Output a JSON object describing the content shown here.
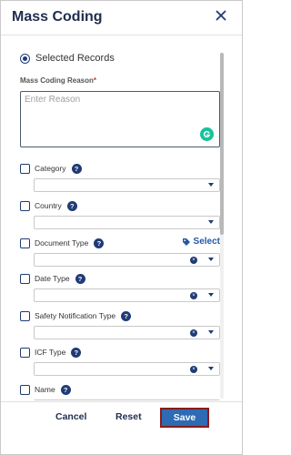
{
  "header": {
    "title": "Mass Coding",
    "close_icon": "close-icon"
  },
  "scope": {
    "selected_records_label": "Selected Records"
  },
  "reason": {
    "label": "Mass Coding Reason",
    "required_marker": "*",
    "placeholder": "Enter Reason",
    "value": "",
    "assistant_icon": "grammarly-icon",
    "assistant_letter": "G"
  },
  "fields": [
    {
      "label": "Category",
      "help": "?",
      "value": "",
      "clearable": false
    },
    {
      "label": "Country",
      "help": "?",
      "value": "",
      "clearable": false
    },
    {
      "label": "Document Type",
      "help": "?",
      "value": "",
      "clearable": true,
      "select_link": "Select"
    },
    {
      "label": "Date Type",
      "help": "?",
      "value": "",
      "clearable": true
    },
    {
      "label": "Safety Notification Type",
      "help": "?",
      "value": "",
      "clearable": true
    },
    {
      "label": "ICF Type",
      "help": "?",
      "value": "",
      "clearable": true
    },
    {
      "label": "Name",
      "help": "?",
      "value": "",
      "clearable": false
    }
  ],
  "footer": {
    "cancel": "Cancel",
    "reset": "Reset",
    "save": "Save"
  },
  "colors": {
    "primary": "#1f3a76",
    "save_bg": "#2d6bb3",
    "save_border": "#8b1a1a",
    "required": "#d23b2e",
    "link": "#2457a8"
  }
}
